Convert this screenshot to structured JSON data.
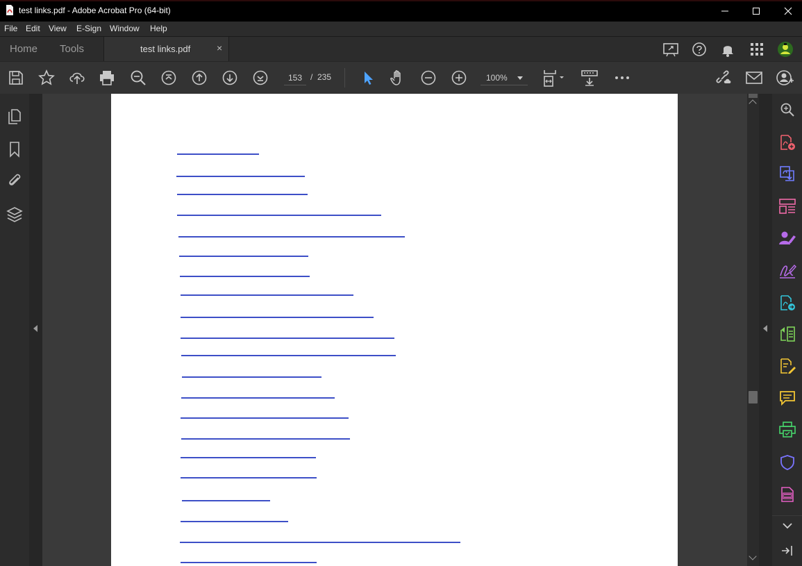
{
  "window": {
    "title": "test links.pdf - Adobe Acrobat Pro (64-bit)",
    "controls": [
      "minimize-icon",
      "maximize-icon",
      "close-icon"
    ]
  },
  "menu": {
    "file": "File",
    "edit": "Edit",
    "view": "View",
    "esign": "E-Sign",
    "window": "Window",
    "help": "Help"
  },
  "tabs": {
    "home": "Home",
    "tools": "Tools",
    "document": "test links.pdf",
    "close": "×",
    "right_icons": [
      "share-screen-icon",
      "help-icon",
      "bell-icon",
      "apps-grid-icon",
      "user-avatar-icon"
    ]
  },
  "toolbar": {
    "icons": [
      "save-icon",
      "star-icon",
      "cloud-upload-icon",
      "print-icon",
      "find-icon",
      "first-page-icon",
      "previous-page-icon",
      "next-page-icon",
      "last-page-icon",
      "select-cursor-icon",
      "hand-tool-icon",
      "zoom-out-icon",
      "zoom-in-icon",
      "fit-page-icon",
      "scrolling-mode-icon",
      "more-icon",
      "link-icon",
      "mail-icon",
      "account-icon"
    ],
    "current_page": "153",
    "page_separator": "/",
    "total_pages": "235",
    "zoom": "100%"
  },
  "left_panel": {
    "icons": [
      "page-thumbnails-icon",
      "bookmarks-icon",
      "attachments-icon",
      "layers-icon"
    ]
  },
  "right_panel": {
    "icons": [
      "search-icon",
      "create-pdf-icon",
      "export-pdf-icon",
      "organize-pages-icon",
      "request-signature-icon",
      "fill-sign-icon",
      "send-for-review-icon",
      "compare-files-icon",
      "edit-pdf-icon",
      "comment-icon",
      "print-production-icon",
      "protect-icon",
      "pdf-document-icon",
      "chevron-down-icon",
      "expand-panel-icon"
    ],
    "colors": {
      "search": "#bfbfbf",
      "create": "#f0616e",
      "export": "#6f7dff",
      "organize": "#f06aa8",
      "request_sign": "#b66be9",
      "fill_sign": "#b66be9",
      "send_review": "#33c3d8",
      "compare": "#7fd35a",
      "edit": "#f3c634",
      "comment": "#f3c634",
      "print_production": "#47d56b",
      "protect": "#7a74ff",
      "pdf_doc": "#e35fc3"
    }
  },
  "document": {
    "link_color": "#3d4fc7",
    "link_count": 20
  }
}
